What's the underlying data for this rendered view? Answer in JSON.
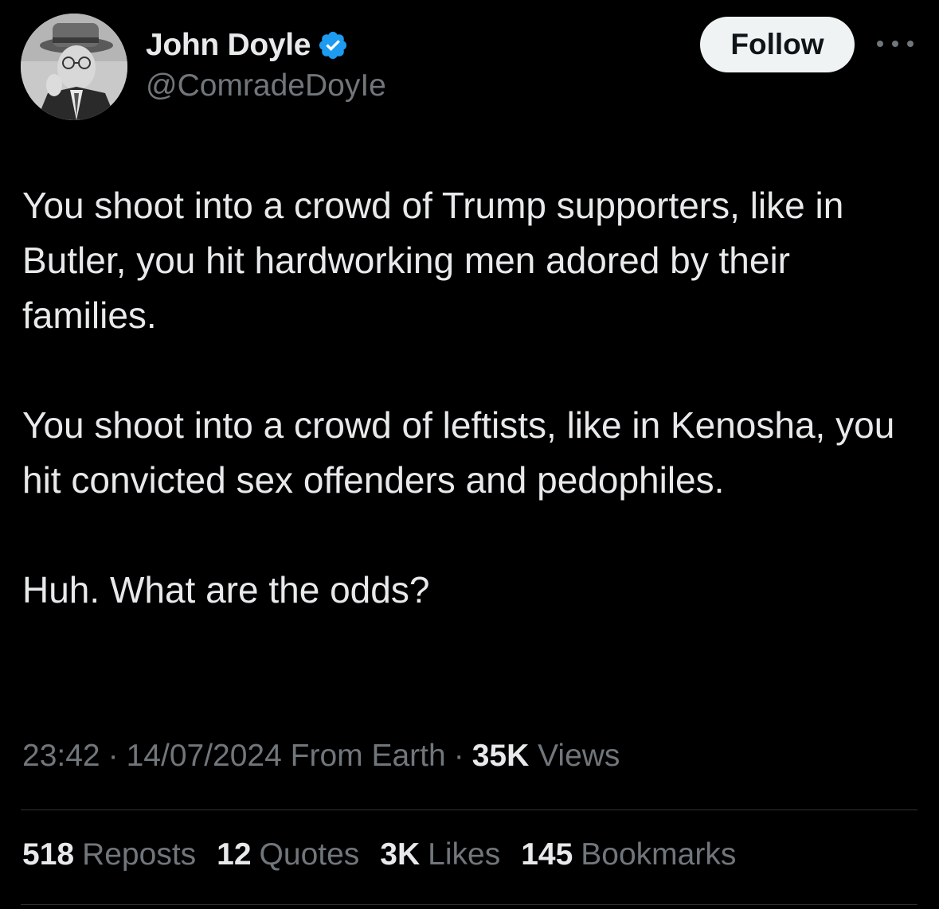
{
  "author": {
    "name": "John Doyle",
    "handle": "@ComradeDoyIe",
    "verified_icon": "verified-badge-icon",
    "verified_color": "#1d9bf0",
    "avatar_icon": "profile-photo"
  },
  "actions": {
    "follow_label": "Follow",
    "more_icon": "more-horizontal-icon"
  },
  "tweet": {
    "paragraphs": [
      "You shoot into a crowd of Trump supporters, like in Butler, you hit hardworking men adored by their families.",
      "You shoot into a crowd of leftists, like in Kenosha, you hit convicted sex offenders and pedophiles.",
      "Huh. What are the odds?"
    ]
  },
  "meta": {
    "time": "23:42",
    "date": "14/07/2024",
    "source": "From Earth",
    "separator": "·",
    "views_count": "35K",
    "views_label": "Views"
  },
  "stats": {
    "reposts_count": "518",
    "reposts_label": "Reposts",
    "quotes_count": "12",
    "quotes_label": "Quotes",
    "likes_count": "3K",
    "likes_label": "Likes",
    "bookmarks_count": "145",
    "bookmarks_label": "Bookmarks"
  },
  "colors": {
    "background": "#000000",
    "primary_text": "#e7e9ea",
    "secondary_text": "#71767b",
    "divider": "#2f3336",
    "follow_button_bg": "#eff3f4"
  }
}
